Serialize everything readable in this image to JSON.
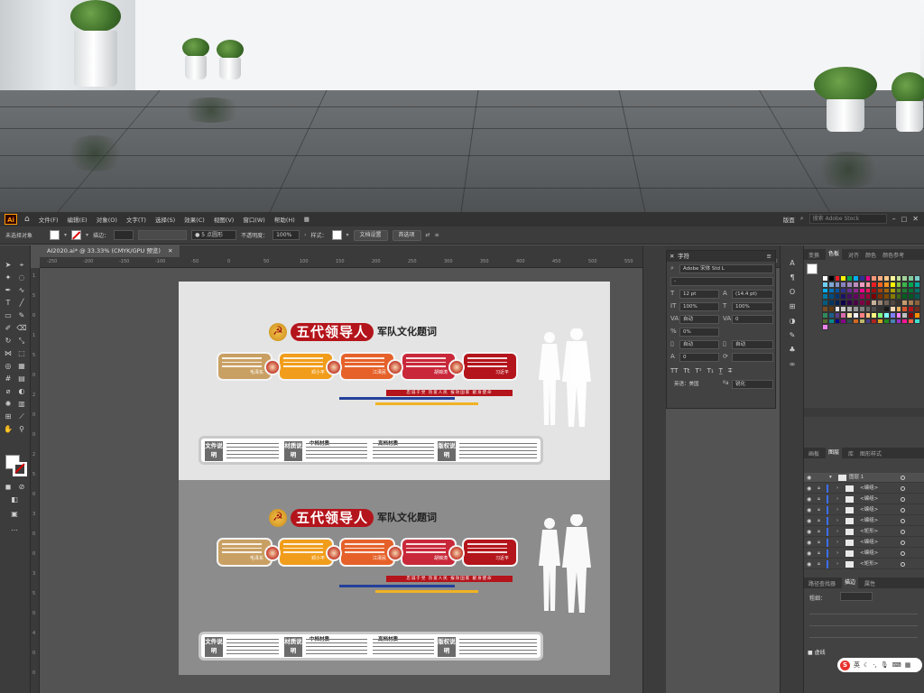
{
  "menubar": {
    "app_logo": "Ai",
    "items": [
      "文件(F)",
      "编辑(E)",
      "对象(O)",
      "文字(T)",
      "选择(S)",
      "效果(C)",
      "视图(V)",
      "窗口(W)",
      "帮助(H)"
    ],
    "workspace": "版面",
    "search_placeholder": "搜索 Adobe Stock"
  },
  "controlbar": {
    "selection_status": "未选择对象",
    "stroke_label": "描边：",
    "brush_size": "5 点圆形",
    "opacity_label": "不透明度：",
    "opacity_value": "100%",
    "style_label": "样式：",
    "doc_setup_button": "文档设置",
    "preferences_button": "首选项"
  },
  "document": {
    "tab_title": "AI2020.ai* @ 33.33% (CMYK/GPU 预览)"
  },
  "rulers": {
    "h_ticks": [
      "-250",
      "-200",
      "-150",
      "-100",
      "-50",
      "0",
      "50",
      "100",
      "150",
      "200",
      "250",
      "300",
      "350",
      "400",
      "450",
      "500",
      "550",
      "600",
      "650",
      "700",
      "750"
    ],
    "v_ticks": [
      "1",
      "5",
      "0",
      "1",
      "5",
      "0",
      "2",
      "0",
      "0",
      "2",
      "5",
      "0",
      "3",
      "0",
      "0",
      "3",
      "5",
      "0",
      "4",
      "0",
      "0"
    ]
  },
  "artwork": {
    "title_main": "五代领导人",
    "title_sub": "军队文化题词",
    "hammer_glyph": "☭",
    "card_names": [
      "毛泽东",
      "邓小平",
      "江泽民",
      "胡锦涛",
      "习近平"
    ],
    "card_colors": [
      "#c9a063",
      "#f19d1b",
      "#e6612a",
      "#c9283a",
      "#b4141b"
    ],
    "slogan": "忠诚于党  热爱人民  报效国家  献身使命",
    "info_labels": [
      "文件说明",
      "材质说明",
      "版权说明"
    ],
    "info_heads": [
      "中档材质",
      "高档材质"
    ]
  },
  "character_panel": {
    "title": "字符",
    "font_family": "Adobe 宋体 Std L",
    "font_style": "-",
    "font_size": "12 pt",
    "leading": "(14.4 pt)",
    "kerning": "自动",
    "tracking": "0",
    "vscale": "100%",
    "hscale": "100%",
    "baseline": "0%",
    "tsume": "自动",
    "auto_a": "自动",
    "auto_b": "0",
    "language": "英语：美国",
    "antialias": "锐化"
  },
  "right_panel": {
    "top_tabs": [
      "变换",
      "色板",
      "对齐",
      "颜色",
      "颜色参考"
    ],
    "layer_tabs": [
      "画板",
      "图层",
      "库",
      "图形样式"
    ],
    "layer_top": "图层 1",
    "layers": [
      "<编组>",
      "<编组>",
      "<编组>",
      "<编组>",
      "<矩形>",
      "<编组>",
      "<编组>",
      "<矩形>"
    ],
    "bottom_tabs": [
      "路径查找器",
      "描边",
      "属性"
    ],
    "stroke_weight_label": "粗细：",
    "dashed_label": "虚线"
  },
  "swatch_colors": [
    "#ffffff",
    "#000000",
    "#ed1c24",
    "#fff200",
    "#00a651",
    "#00aeef",
    "#2e3192",
    "#ec008c",
    "#f7977a",
    "#f9ad81",
    "#fdc68a",
    "#fff79a",
    "#c4df9b",
    "#a2d39c",
    "#82ca9d",
    "#7bcdc8",
    "#6ecff6",
    "#7ea7d8",
    "#8493ca",
    "#8882be",
    "#a187be",
    "#bc8dbf",
    "#f49ac2",
    "#f6989d",
    "#ed1c24",
    "#f26522",
    "#f7941d",
    "#fff200",
    "#8dc63f",
    "#39b54a",
    "#00a651",
    "#00a99d",
    "#00aeef",
    "#0072bc",
    "#0054a6",
    "#2e3192",
    "#662d91",
    "#92278f",
    "#ec008c",
    "#ed145b",
    "#9e0b0f",
    "#a0410d",
    "#a36209",
    "#aba000",
    "#598527",
    "#1a7b30",
    "#007236",
    "#00746b",
    "#0076a3",
    "#004b80",
    "#003471",
    "#1b1464",
    "#440e62",
    "#630460",
    "#9e005d",
    "#9e0039",
    "#790000",
    "#7b2e00",
    "#7d4900",
    "#827b00",
    "#406618",
    "#005e20",
    "#005826",
    "#005952",
    "#005b7f",
    "#003663",
    "#002157",
    "#0d004c",
    "#32004b",
    "#4b0049",
    "#7b0046",
    "#7a0026",
    "#c7b299",
    "#998675",
    "#736357",
    "#534741",
    "#37302d",
    "#c69c6d",
    "#a67c52",
    "#8c6239",
    "#754c24",
    "#603913",
    "#e6e6e6",
    "#cccccc",
    "#b3b3b3",
    "#999999",
    "#808080",
    "#666666",
    "#4d4d4d",
    "#333333",
    "#1a1a1a",
    "#f5d9b6",
    "#e9b35f",
    "#d9542b",
    "#b5121b",
    "#6d2c1e",
    "#2f8a5c",
    "#1d5e8a",
    "#5b3d8c",
    "#d86bad",
    "#ffe6a8",
    "#f2f2f2",
    "#ff7f7f",
    "#ffbf7f",
    "#ffff7f",
    "#7fff7f",
    "#7fffff",
    "#7f7fff",
    "#ff7fff",
    "#c0c0c0",
    "#8b0000",
    "#ff8c00",
    "#556b2f",
    "#008b8b",
    "#00008b",
    "#8b008b",
    "#2f4f4f",
    "#d2691e",
    "#bdb76b",
    "#483d8b",
    "#b22222",
    "#daa520",
    "#228b22",
    "#4682b4",
    "#9932cc",
    "#ff1493",
    "#ff6347",
    "#40e0d0",
    "#ee82ee"
  ],
  "ime": {
    "logo": "S",
    "mode": "英"
  }
}
